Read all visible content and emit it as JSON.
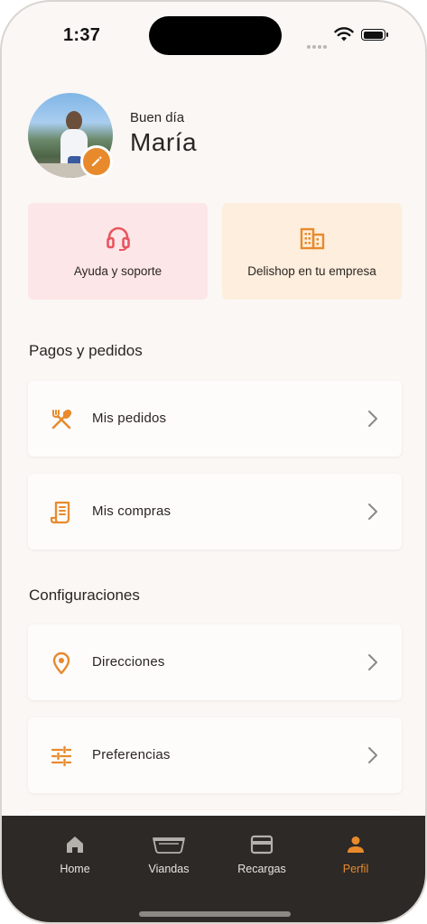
{
  "status_bar": {
    "time": "1:37"
  },
  "profile": {
    "greeting": "Buen día",
    "name": "María"
  },
  "quick_actions": [
    {
      "label": "Ayuda y soporte",
      "icon": "headset-icon"
    },
    {
      "label": "Delishop en tu empresa",
      "icon": "building-icon"
    }
  ],
  "sections": [
    {
      "title": "Pagos y pedidos",
      "items": [
        {
          "label": "Mis pedidos",
          "icon": "utensils-icon"
        },
        {
          "label": "Mis compras",
          "icon": "receipt-icon"
        }
      ]
    },
    {
      "title": "Configuraciones",
      "items": [
        {
          "label": "Direcciones",
          "icon": "location-pin-icon"
        },
        {
          "label": "Preferencias",
          "icon": "sliders-icon"
        }
      ]
    }
  ],
  "tab_bar": {
    "tabs": [
      {
        "label": "Home",
        "icon": "home-icon"
      },
      {
        "label": "Viandas",
        "icon": "food-container-icon"
      },
      {
        "label": "Recargas",
        "icon": "credit-card-icon"
      },
      {
        "label": "Perfil",
        "icon": "person-icon"
      }
    ],
    "active": "Perfil"
  },
  "colors": {
    "accent": "#e88a2c",
    "background": "#faf7f4",
    "support_card": "#fde6e7",
    "company_card": "#fdeedd",
    "tab_bar": "#2d2926",
    "support_icon": "#e8555f"
  }
}
